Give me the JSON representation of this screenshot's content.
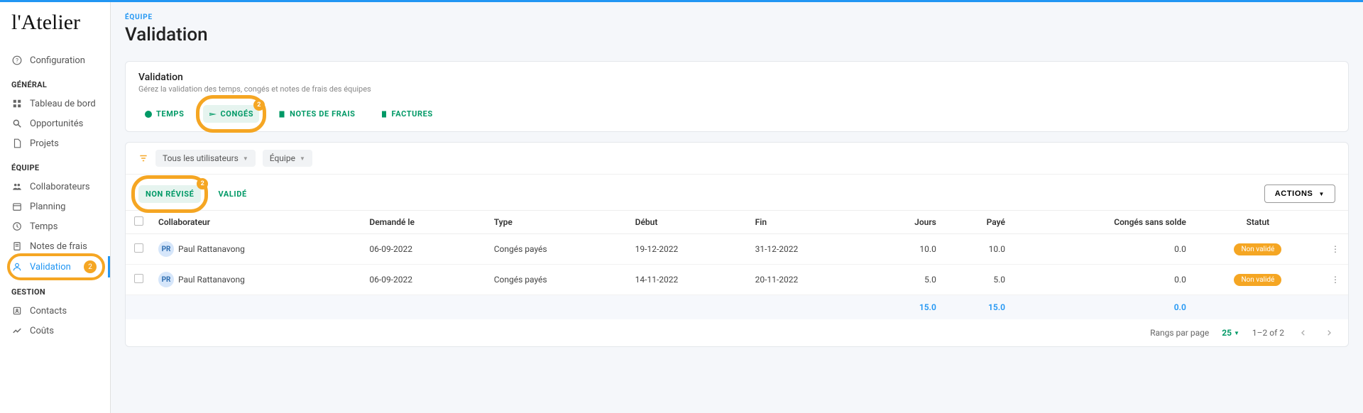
{
  "logo": "l'Atelier",
  "sidebar": {
    "top": [
      {
        "label": "Configuration",
        "icon": "help"
      }
    ],
    "general_title": "GÉNÉRAL",
    "general": [
      {
        "label": "Tableau de bord",
        "icon": "dashboard"
      },
      {
        "label": "Opportunités",
        "icon": "magnify"
      },
      {
        "label": "Projets",
        "icon": "file"
      }
    ],
    "equipe_title": "ÉQUIPE",
    "equipe": [
      {
        "label": "Collaborateurs",
        "icon": "people"
      },
      {
        "label": "Planning",
        "icon": "calendar"
      },
      {
        "label": "Temps",
        "icon": "clock"
      },
      {
        "label": "Notes de frais",
        "icon": "notes"
      },
      {
        "label": "Validation",
        "icon": "approve",
        "active": true,
        "badge": "2"
      }
    ],
    "gestion_title": "GESTION",
    "gestion": [
      {
        "label": "Contacts",
        "icon": "contacts"
      },
      {
        "label": "Coûts",
        "icon": "chart"
      }
    ]
  },
  "breadcrumb": "ÉQUIPE",
  "page_title": "Validation",
  "card": {
    "title": "Validation",
    "subtitle": "Gérez la validation des temps, congés et notes de frais des équipes"
  },
  "tabs": [
    {
      "label": "TEMPS",
      "icon": "clock"
    },
    {
      "label": "CONGÉS",
      "icon": "flight",
      "active": true,
      "badge": "2",
      "highlight": true
    },
    {
      "label": "NOTES DE FRAIS",
      "icon": "notes"
    },
    {
      "label": "FACTURES",
      "icon": "receipt"
    }
  ],
  "filters": [
    {
      "label": "Tous les utilisateurs"
    },
    {
      "label": "Équipe"
    }
  ],
  "subtabs": [
    {
      "label": "NON RÉVISÉ",
      "active": true,
      "highlight": true,
      "badge": "2"
    },
    {
      "label": "VALIDÉ"
    }
  ],
  "actions_btn": "ACTIONS",
  "table": {
    "headers": {
      "collaborateur": "Collaborateur",
      "demande": "Demandé le",
      "type": "Type",
      "debut": "Début",
      "fin": "Fin",
      "jours": "Jours",
      "paye": "Payé",
      "conges_sans_solde": "Congés sans solde",
      "statut": "Statut"
    },
    "rows": [
      {
        "avatar": "PR",
        "name": "Paul  Rattanavong",
        "demande": "06-09-2022",
        "type": "Congés payés",
        "debut": "19-12-2022",
        "fin": "31-12-2022",
        "jours": "10.0",
        "paye": "10.0",
        "sans_solde": "0.0",
        "statut": "Non validé"
      },
      {
        "avatar": "PR",
        "name": "Paul  Rattanavong",
        "demande": "06-09-2022",
        "type": "Congés payés",
        "debut": "14-11-2022",
        "fin": "20-11-2022",
        "jours": "5.0",
        "paye": "5.0",
        "sans_solde": "0.0",
        "statut": "Non validé"
      }
    ],
    "totals": {
      "jours": "15.0",
      "paye": "15.0",
      "sans_solde": "0.0"
    }
  },
  "pagination": {
    "rows_label": "Rangs par page",
    "rows_value": "25",
    "range": "1–2 of 2"
  }
}
